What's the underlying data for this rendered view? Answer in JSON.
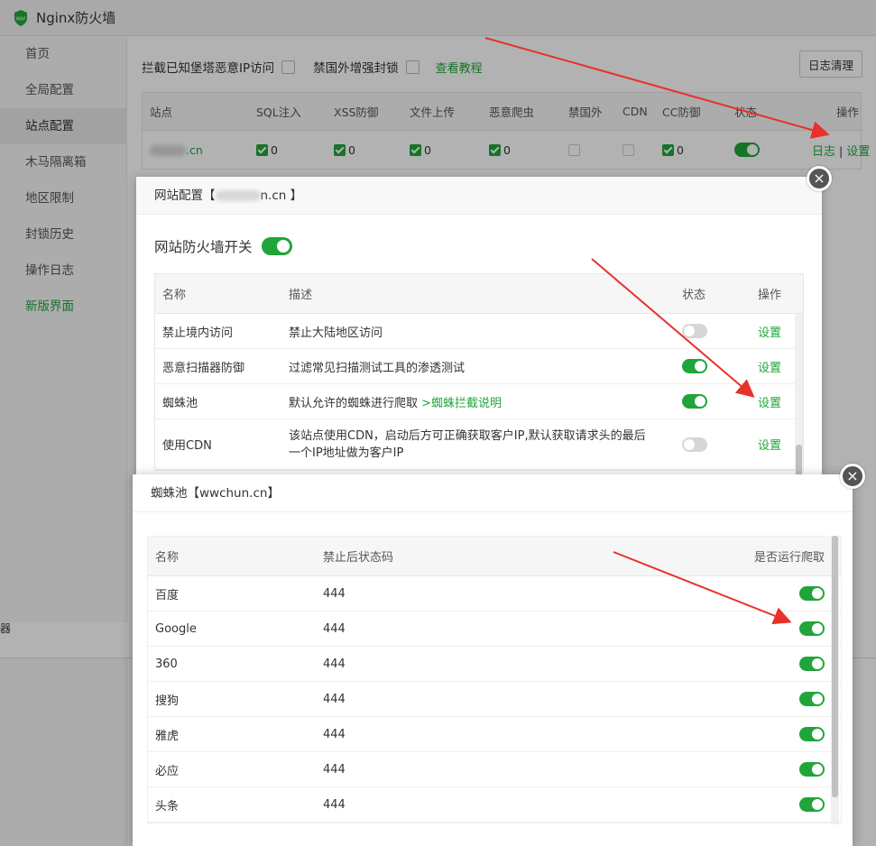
{
  "app": {
    "title": "Nginx防火墙"
  },
  "sidebar": {
    "items": [
      {
        "label": "首页"
      },
      {
        "label": "全局配置"
      },
      {
        "label": "站点配置"
      },
      {
        "label": "木马隔离箱"
      },
      {
        "label": "地区限制"
      },
      {
        "label": "封锁历史"
      },
      {
        "label": "操作日志"
      },
      {
        "label": "新版界面"
      }
    ]
  },
  "topbar": {
    "block_bt_label": "拦截已知堡塔恶意IP访问",
    "block_foreign_label": "禁国外增强封锁",
    "tutorial_link": "查看教程",
    "clear_log_button": "日志清理"
  },
  "site_table": {
    "headers": [
      "站点",
      "SQL注入",
      "XSS防御",
      "文件上传",
      "恶意爬虫",
      "禁国外",
      "CDN",
      "CC防御",
      "状态",
      "操作"
    ],
    "row": {
      "site_suffix": ".cn",
      "sql": "0",
      "xss": "0",
      "upload": "0",
      "crawler": "0",
      "cc": "0",
      "log_link": "日志",
      "separator": "|",
      "settings_link": "设置"
    }
  },
  "site_dialog": {
    "title_prefix": "网站配置【",
    "title_suffix": "n.cn 】",
    "close": "×",
    "switch_label": "网站防火墙开关",
    "headers": [
      "名称",
      "描述",
      "状态",
      "操作"
    ],
    "rows": [
      {
        "name": "禁止境内访问",
        "desc": "禁止大陆地区访问",
        "link": "",
        "state": "off",
        "action": "设置"
      },
      {
        "name": "恶意扫描器防御",
        "desc": "过滤常见扫描测试工具的渗透测试",
        "link": "",
        "state": "on",
        "action": "设置"
      },
      {
        "name": "蜘蛛池",
        "desc": "默认允许的蜘蛛进行爬取",
        "link": ">蜘蛛拦截说明",
        "state": "on",
        "action": "设置"
      },
      {
        "name": "使用CDN",
        "desc": "该站点使用CDN，启动后方可正确获取客户IP,默认获取请求头的最后一个IP地址做为客户IP",
        "link": "",
        "state": "off",
        "action": "设置"
      }
    ]
  },
  "spider_dialog": {
    "title": "蜘蛛池【wwchun.cn】",
    "close": "×",
    "headers": [
      "名称",
      "禁止后状态码",
      "是否运行爬取"
    ],
    "rows": [
      {
        "name": "百度",
        "code": "444",
        "state": "on"
      },
      {
        "name": "Google",
        "code": "444",
        "state": "on"
      },
      {
        "name": "360",
        "code": "444",
        "state": "on"
      },
      {
        "name": "搜狗",
        "code": "444",
        "state": "on"
      },
      {
        "name": "雅虎",
        "code": "444",
        "state": "on"
      },
      {
        "name": "必应",
        "code": "444",
        "state": "on"
      },
      {
        "name": "头条",
        "code": "444",
        "state": "on"
      }
    ]
  },
  "behind": {
    "fragment": "器"
  },
  "colors": {
    "accent": "#20a53a",
    "annotation_arrow": "#e8312a"
  }
}
